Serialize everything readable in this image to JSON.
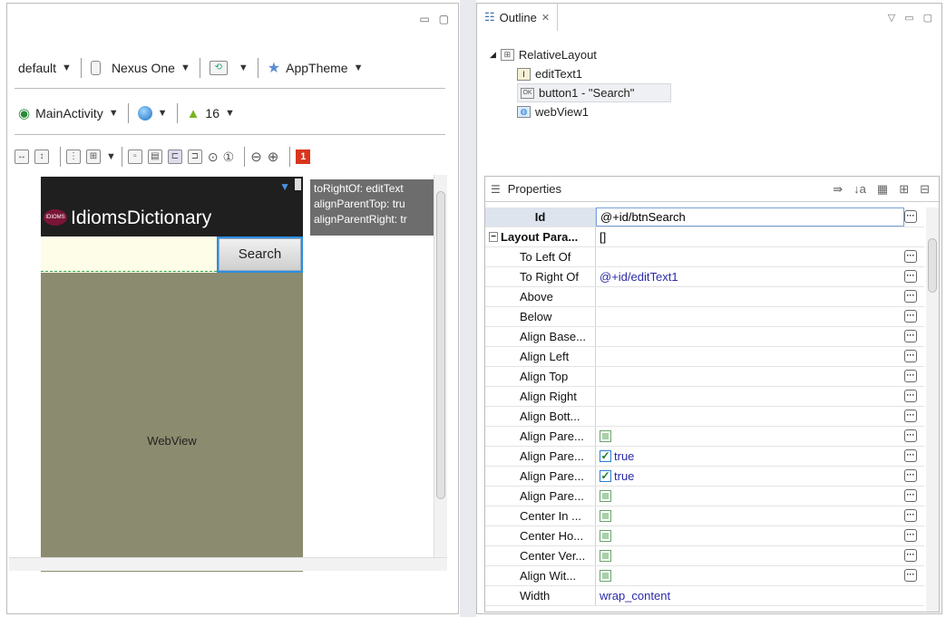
{
  "editor": {
    "toolbar1": {
      "theme_variant": "default",
      "device": "Nexus One",
      "app_theme": "AppTheme"
    },
    "toolbar2": {
      "activity": "MainActivity",
      "api_level": "16"
    },
    "error_badge": "1",
    "app_title": "IdiomsDictionary",
    "logo_text": "IDIOMS",
    "search_button": "Search",
    "webview_label": "WebView",
    "tooltip": [
      "toRightOf: editText",
      "alignParentTop: tru",
      "alignParentRight: tr"
    ]
  },
  "outline": {
    "tab_title": "Outline",
    "root": "RelativeLayout",
    "children": [
      "editText1",
      "button1 - \"Search\"",
      "webView1"
    ]
  },
  "properties": {
    "title": "Properties",
    "id_label": "Id",
    "id_value": "@+id/btnSearch",
    "group_label": "Layout Para...",
    "group_value": "[]",
    "rows": [
      {
        "key": "To Left Of",
        "value": ""
      },
      {
        "key": "To Right Of",
        "value": "@+id/editText1"
      },
      {
        "key": "Above",
        "value": ""
      },
      {
        "key": "Below",
        "value": ""
      },
      {
        "key": "Align Base...",
        "value": ""
      },
      {
        "key": "Align Left",
        "value": ""
      },
      {
        "key": "Align Top",
        "value": ""
      },
      {
        "key": "Align Right",
        "value": ""
      },
      {
        "key": "Align Bott...",
        "value": ""
      },
      {
        "key": "Align Pare...",
        "value": "",
        "checkbox": "empty"
      },
      {
        "key": "Align Pare...",
        "value": "true",
        "checkbox": "checked"
      },
      {
        "key": "Align Pare...",
        "value": "true",
        "checkbox": "checked"
      },
      {
        "key": "Align Pare...",
        "value": "",
        "checkbox": "empty"
      },
      {
        "key": "Center In ...",
        "value": "",
        "checkbox": "empty"
      },
      {
        "key": "Center Ho...",
        "value": "",
        "checkbox": "empty"
      },
      {
        "key": "Center Ver...",
        "value": "",
        "checkbox": "empty"
      },
      {
        "key": "Align Wit...",
        "value": "",
        "checkbox": "empty"
      }
    ],
    "width_label": "Width",
    "width_value": "wrap_content"
  }
}
